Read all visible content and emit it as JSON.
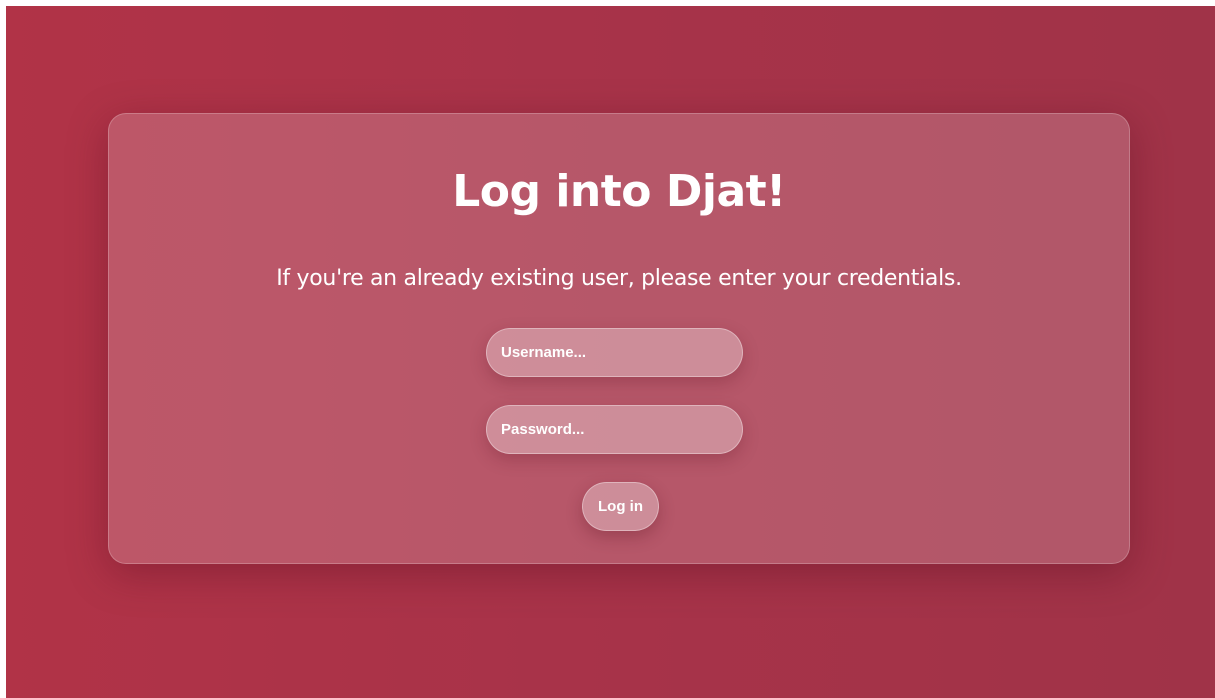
{
  "login": {
    "title": "Log into Djat!",
    "subtitle": "If you're an already existing user, please enter your credentials.",
    "username": {
      "placeholder": "Username...",
      "value": ""
    },
    "password": {
      "placeholder": "Password...",
      "value": ""
    },
    "submit_label": "Log in"
  },
  "colors": {
    "background": "#b13347",
    "text": "#ffffff"
  }
}
